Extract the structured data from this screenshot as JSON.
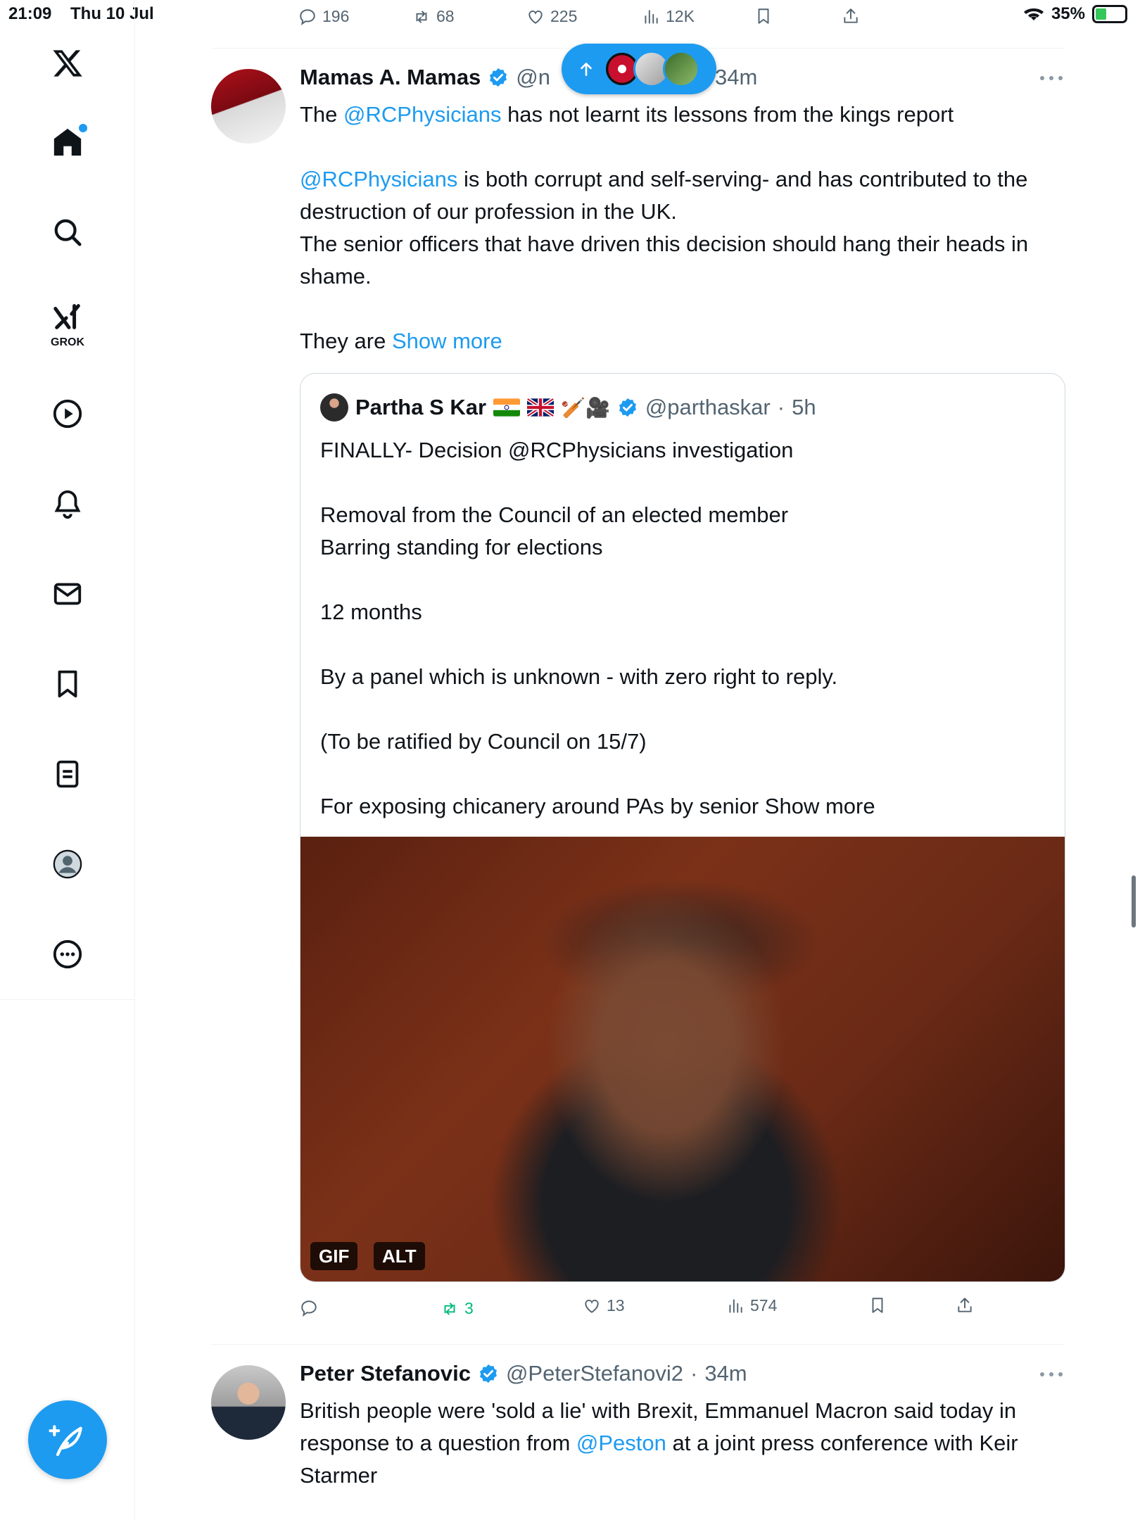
{
  "status_bar": {
    "time": "21:09",
    "date": "Thu 10 Jul",
    "battery": "35%",
    "battery_level": 0.35
  },
  "top_tweet_actions": {
    "replies": "196",
    "reposts": "68",
    "likes": "225",
    "views": "12K"
  },
  "sidebar": {
    "items": [
      "home",
      "search",
      "grok",
      "videos",
      "notifications",
      "messages",
      "bookmarks",
      "lists",
      "profile",
      "more"
    ],
    "grok_label": "GROK"
  },
  "new_posts_pill": {
    "icon": "arrow-up-icon"
  },
  "tweet1": {
    "author": "Mamas A. Mamas",
    "handle": "@n",
    "time": "34m",
    "text_line1_prefix": "The ",
    "text_line1_mention": "@RCPhysicians",
    "text_line1_suffix": " has not learnt its lessons from the kings report",
    "para2_mention": "@RCPhysicians",
    "para2_text": " is both corrupt and self-serving- and has contributed to the destruction of our profession in the UK.",
    "para3_text": "The senior officers that have driven this decision should hang their heads in shame.",
    "para4_text": "They are ",
    "show_more": "Show more",
    "actions": {
      "replies": "",
      "reposts": "3",
      "likes": "13",
      "views": "574"
    }
  },
  "quote": {
    "author": "Partha S Kar",
    "emojis": "🏏🎥",
    "handle": "@parthaskar",
    "time": "5h",
    "text": "FINALLY- Decision @RCPhysicians investigation\n\nRemoval from the Council of an elected member\nBarring standing for elections\n\n12 months\n\nBy a panel which is unknown - with zero right to reply.\n\n(To be ratified by Council on 15/7)\n\nFor exposing chicanery around PAs by senior Show more",
    "gif_badge": "GIF",
    "alt_badge": "ALT"
  },
  "tweet2": {
    "author": "Peter Stefanovic",
    "handle": "@PeterStefanovi2",
    "time": "34m",
    "text_prefix": "British people were 'sold a lie' with Brexit, Emmanuel Macron said today in response to a question from ",
    "mention": "@Peston",
    "text_suffix": " at a joint press conference with Keir Starmer"
  },
  "colors": {
    "accent": "#1d9bf0",
    "repost_active": "#00ba7c",
    "muted": "#536471"
  }
}
